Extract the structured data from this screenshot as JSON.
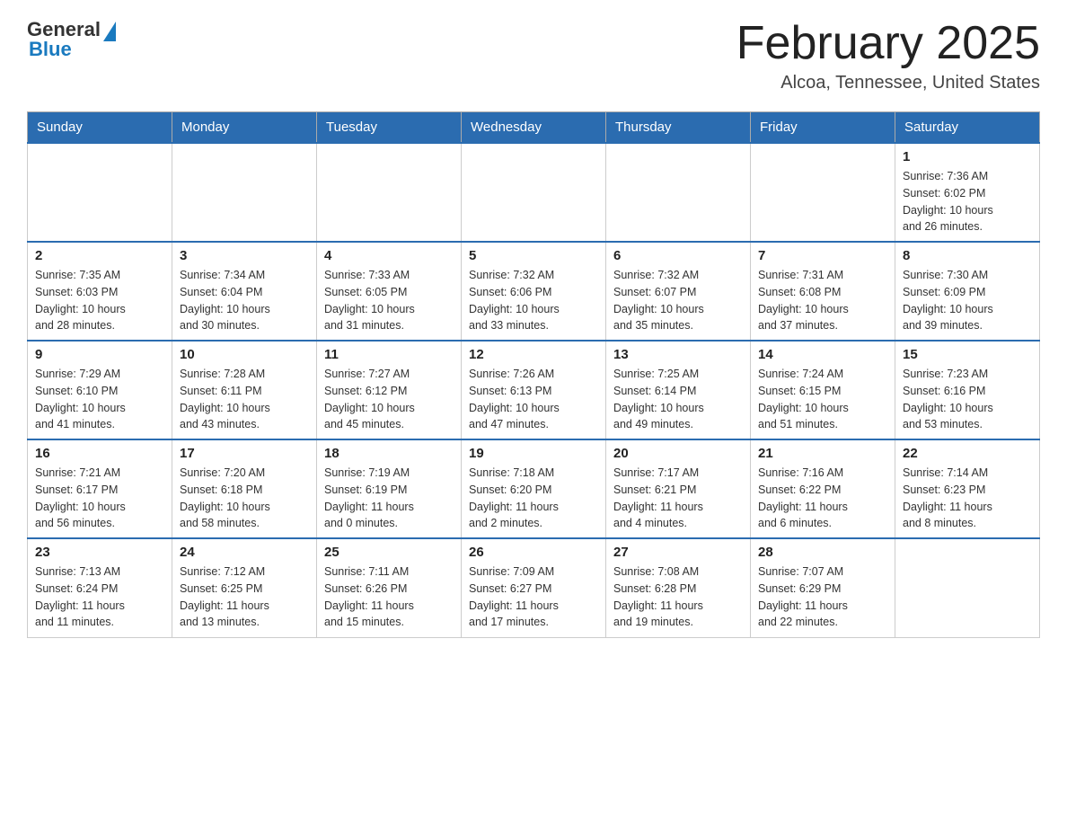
{
  "header": {
    "logo_general": "General",
    "logo_blue": "Blue",
    "title": "February 2025",
    "subtitle": "Alcoa, Tennessee, United States"
  },
  "days_of_week": [
    "Sunday",
    "Monday",
    "Tuesday",
    "Wednesday",
    "Thursday",
    "Friday",
    "Saturday"
  ],
  "weeks": [
    [
      {
        "day": "",
        "info": ""
      },
      {
        "day": "",
        "info": ""
      },
      {
        "day": "",
        "info": ""
      },
      {
        "day": "",
        "info": ""
      },
      {
        "day": "",
        "info": ""
      },
      {
        "day": "",
        "info": ""
      },
      {
        "day": "1",
        "info": "Sunrise: 7:36 AM\nSunset: 6:02 PM\nDaylight: 10 hours\nand 26 minutes."
      }
    ],
    [
      {
        "day": "2",
        "info": "Sunrise: 7:35 AM\nSunset: 6:03 PM\nDaylight: 10 hours\nand 28 minutes."
      },
      {
        "day": "3",
        "info": "Sunrise: 7:34 AM\nSunset: 6:04 PM\nDaylight: 10 hours\nand 30 minutes."
      },
      {
        "day": "4",
        "info": "Sunrise: 7:33 AM\nSunset: 6:05 PM\nDaylight: 10 hours\nand 31 minutes."
      },
      {
        "day": "5",
        "info": "Sunrise: 7:32 AM\nSunset: 6:06 PM\nDaylight: 10 hours\nand 33 minutes."
      },
      {
        "day": "6",
        "info": "Sunrise: 7:32 AM\nSunset: 6:07 PM\nDaylight: 10 hours\nand 35 minutes."
      },
      {
        "day": "7",
        "info": "Sunrise: 7:31 AM\nSunset: 6:08 PM\nDaylight: 10 hours\nand 37 minutes."
      },
      {
        "day": "8",
        "info": "Sunrise: 7:30 AM\nSunset: 6:09 PM\nDaylight: 10 hours\nand 39 minutes."
      }
    ],
    [
      {
        "day": "9",
        "info": "Sunrise: 7:29 AM\nSunset: 6:10 PM\nDaylight: 10 hours\nand 41 minutes."
      },
      {
        "day": "10",
        "info": "Sunrise: 7:28 AM\nSunset: 6:11 PM\nDaylight: 10 hours\nand 43 minutes."
      },
      {
        "day": "11",
        "info": "Sunrise: 7:27 AM\nSunset: 6:12 PM\nDaylight: 10 hours\nand 45 minutes."
      },
      {
        "day": "12",
        "info": "Sunrise: 7:26 AM\nSunset: 6:13 PM\nDaylight: 10 hours\nand 47 minutes."
      },
      {
        "day": "13",
        "info": "Sunrise: 7:25 AM\nSunset: 6:14 PM\nDaylight: 10 hours\nand 49 minutes."
      },
      {
        "day": "14",
        "info": "Sunrise: 7:24 AM\nSunset: 6:15 PM\nDaylight: 10 hours\nand 51 minutes."
      },
      {
        "day": "15",
        "info": "Sunrise: 7:23 AM\nSunset: 6:16 PM\nDaylight: 10 hours\nand 53 minutes."
      }
    ],
    [
      {
        "day": "16",
        "info": "Sunrise: 7:21 AM\nSunset: 6:17 PM\nDaylight: 10 hours\nand 56 minutes."
      },
      {
        "day": "17",
        "info": "Sunrise: 7:20 AM\nSunset: 6:18 PM\nDaylight: 10 hours\nand 58 minutes."
      },
      {
        "day": "18",
        "info": "Sunrise: 7:19 AM\nSunset: 6:19 PM\nDaylight: 11 hours\nand 0 minutes."
      },
      {
        "day": "19",
        "info": "Sunrise: 7:18 AM\nSunset: 6:20 PM\nDaylight: 11 hours\nand 2 minutes."
      },
      {
        "day": "20",
        "info": "Sunrise: 7:17 AM\nSunset: 6:21 PM\nDaylight: 11 hours\nand 4 minutes."
      },
      {
        "day": "21",
        "info": "Sunrise: 7:16 AM\nSunset: 6:22 PM\nDaylight: 11 hours\nand 6 minutes."
      },
      {
        "day": "22",
        "info": "Sunrise: 7:14 AM\nSunset: 6:23 PM\nDaylight: 11 hours\nand 8 minutes."
      }
    ],
    [
      {
        "day": "23",
        "info": "Sunrise: 7:13 AM\nSunset: 6:24 PM\nDaylight: 11 hours\nand 11 minutes."
      },
      {
        "day": "24",
        "info": "Sunrise: 7:12 AM\nSunset: 6:25 PM\nDaylight: 11 hours\nand 13 minutes."
      },
      {
        "day": "25",
        "info": "Sunrise: 7:11 AM\nSunset: 6:26 PM\nDaylight: 11 hours\nand 15 minutes."
      },
      {
        "day": "26",
        "info": "Sunrise: 7:09 AM\nSunset: 6:27 PM\nDaylight: 11 hours\nand 17 minutes."
      },
      {
        "day": "27",
        "info": "Sunrise: 7:08 AM\nSunset: 6:28 PM\nDaylight: 11 hours\nand 19 minutes."
      },
      {
        "day": "28",
        "info": "Sunrise: 7:07 AM\nSunset: 6:29 PM\nDaylight: 11 hours\nand 22 minutes."
      },
      {
        "day": "",
        "info": ""
      }
    ]
  ]
}
